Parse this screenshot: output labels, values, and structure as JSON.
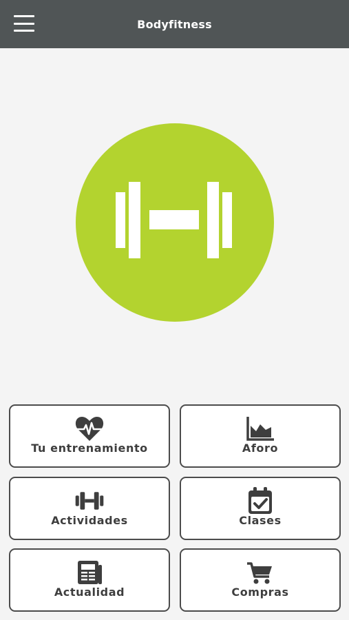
{
  "header": {
    "title": "Bodyfitness",
    "menu_icon": "hamburger-menu-icon",
    "background_color": "#505556"
  },
  "logo": {
    "icon": "dumbbell-icon",
    "circle_color": "#b3d32f"
  },
  "tiles": [
    {
      "label": "Tu entrenamiento",
      "icon": "heartbeat-icon"
    },
    {
      "label": "Aforo",
      "icon": "area-chart-icon"
    },
    {
      "label": "Actividades",
      "icon": "dumbbell-icon"
    },
    {
      "label": "Clases",
      "icon": "calendar-check-icon"
    },
    {
      "label": "Actualidad",
      "icon": "newspaper-icon"
    },
    {
      "label": "Compras",
      "icon": "shopping-cart-icon"
    }
  ]
}
